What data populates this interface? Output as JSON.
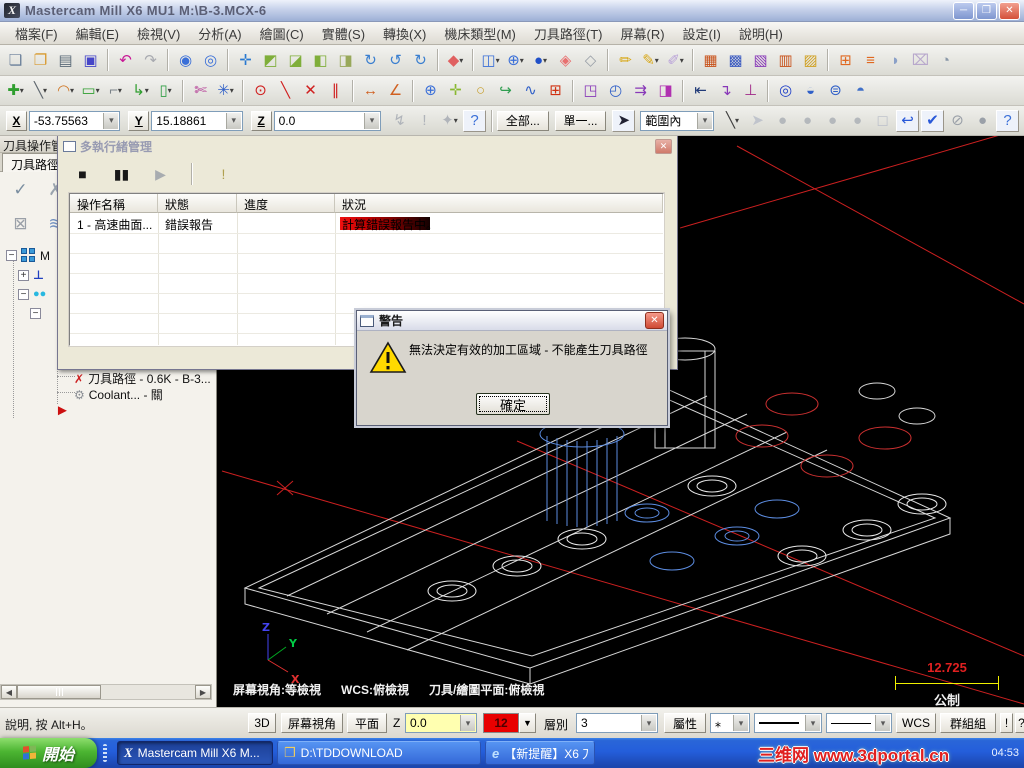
{
  "window": {
    "title": "Mastercam Mill X6 MU1  M:\\B-3.MCX-6",
    "app_initial": "X"
  },
  "menus": [
    "檔案(F)",
    "編輯(E)",
    "檢視(V)",
    "分析(A)",
    "繪圖(C)",
    "實體(S)",
    "轉換(X)",
    "機床類型(M)",
    "刀具路徑(T)",
    "屏幕(R)",
    "設定(I)",
    "說明(H)"
  ],
  "toolbars": {
    "row1": [
      {
        "name": "new-file-icon",
        "glyph": "❏",
        "color": "#6a7f9a"
      },
      {
        "name": "open-file-icon",
        "glyph": "❐",
        "color": "#d89a30"
      },
      {
        "name": "print-icon",
        "glyph": "▤",
        "color": "#5a6a78"
      },
      {
        "name": "save-icon",
        "glyph": "▣",
        "color": "#4646c8"
      },
      {
        "sep": true
      },
      {
        "name": "undo-icon",
        "glyph": "↶",
        "color": "#c81896"
      },
      {
        "name": "redo-icon",
        "glyph": "↷",
        "color": "#a8aab0"
      },
      {
        "sep": true
      },
      {
        "name": "zoom-window-icon",
        "glyph": "◉",
        "color": "#3a6fd8"
      },
      {
        "name": "zoom-unzoom-icon",
        "glyph": "◎",
        "color": "#3a6fd8"
      },
      {
        "sep": true
      },
      {
        "name": "fit-screen-icon",
        "glyph": "✛",
        "color": "#2878d0"
      },
      {
        "name": "gview-top-icon",
        "glyph": "◩",
        "color": "#7fae3a"
      },
      {
        "name": "gview-front-icon",
        "glyph": "◪",
        "color": "#7fae3a"
      },
      {
        "name": "gview-side-icon",
        "glyph": "◧",
        "color": "#7fae3a"
      },
      {
        "name": "gview-back-icon",
        "glyph": "◨",
        "color": "#98a85a"
      },
      {
        "name": "rotate-xy-icon",
        "glyph": "↻",
        "color": "#3a7fd0"
      },
      {
        "name": "rotate-xz-icon",
        "glyph": "↺",
        "color": "#3a7fd0"
      },
      {
        "name": "rotate-yz-icon",
        "glyph": "↻",
        "color": "#3a7fd0"
      },
      {
        "sep": true
      },
      {
        "name": "shading-settings-icon",
        "glyph": "◆",
        "color": "#e06060",
        "caret": true
      },
      {
        "sep": true
      },
      {
        "name": "wireframe-display-icon",
        "glyph": "◫",
        "color": "#3a6fd8",
        "caret": true
      },
      {
        "name": "gview-globe-icon",
        "glyph": "⊕",
        "color": "#3a6fd8",
        "caret": true
      },
      {
        "name": "material-sphere-icon",
        "glyph": "●",
        "color": "#2050c8",
        "caret": true
      },
      {
        "name": "solid-shaded-icon",
        "glyph": "◈",
        "color": "#e87070"
      },
      {
        "name": "solid-wireframe-icon",
        "glyph": "◇",
        "color": "#9aa0a8"
      },
      {
        "sep": true
      },
      {
        "name": "pencil-icon",
        "glyph": "✏",
        "color": "#d8a818"
      },
      {
        "name": "pencil-multi-icon",
        "glyph": "✎",
        "color": "#d8a818",
        "caret": true
      },
      {
        "name": "blank-entity-icon",
        "glyph": "✐",
        "color": "#b8a0d8",
        "caret": true
      },
      {
        "sep": true
      },
      {
        "name": "screen-combine-icon",
        "glyph": "▦",
        "color": "#c85018"
      },
      {
        "name": "screen-result-icon",
        "glyph": "▩",
        "color": "#3858c0"
      },
      {
        "name": "screen-copy-icon",
        "glyph": "▧",
        "color": "#8838b8"
      },
      {
        "name": "screen-grid-icon",
        "glyph": "▥",
        "color": "#c85018"
      },
      {
        "name": "screen-tile-icon",
        "glyph": "▨",
        "color": "#d0a020"
      },
      {
        "sep": true
      },
      {
        "name": "mesh-grid-icon",
        "glyph": "⊞",
        "color": "#e06820"
      },
      {
        "name": "mesh-lines-icon",
        "glyph": "≡",
        "color": "#e06820"
      },
      {
        "name": "shade-half-icon",
        "glyph": "◗",
        "color": "#8aa0c8"
      },
      {
        "name": "erase-tool-icon",
        "glyph": "⌧",
        "color": "#b8a8cc"
      },
      {
        "name": "clipped-edge-icon",
        "glyph": "◔",
        "color": "#8a98a8"
      }
    ],
    "row2": [
      {
        "name": "create-point-icon",
        "glyph": "✚",
        "color": "#2f9e2f",
        "caret": true
      },
      {
        "name": "create-line-icon",
        "glyph": "╲",
        "color": "#606870",
        "caret": true
      },
      {
        "name": "create-arc-icon",
        "glyph": "◠",
        "color": "#d07828",
        "caret": true
      },
      {
        "name": "create-rect-icon",
        "glyph": "▭",
        "color": "#2f9e2f",
        "caret": true
      },
      {
        "name": "create-fillet-icon",
        "glyph": "⌐",
        "color": "#7a8288",
        "caret": true
      },
      {
        "name": "create-spline-icon",
        "glyph": "↳",
        "color": "#2f9e2f",
        "caret": true
      },
      {
        "name": "create-cylinder-icon",
        "glyph": "▯",
        "color": "#2f9e44",
        "caret": true
      },
      {
        "sep": true
      },
      {
        "name": "trim-break-icon",
        "glyph": "✄",
        "color": "#b03090"
      },
      {
        "name": "xform-stretch-icon",
        "glyph": "✳",
        "color": "#3060c8",
        "caret": true
      },
      {
        "sep": true
      },
      {
        "name": "point-origin-icon",
        "glyph": "⊙",
        "color": "#d02020"
      },
      {
        "name": "sketch-line-red-icon",
        "glyph": "╲",
        "color": "#d02020"
      },
      {
        "name": "delete-entities-icon",
        "glyph": "✕",
        "color": "#d02020"
      },
      {
        "name": "delete-duplicates-icon",
        "glyph": "∥",
        "color": "#d02020"
      },
      {
        "sep": true
      },
      {
        "name": "analyze-distance-icon",
        "glyph": "↔",
        "color": "#d06020"
      },
      {
        "name": "analyze-angle-icon",
        "glyph": "∠",
        "color": "#d06020"
      },
      {
        "sep": true
      },
      {
        "name": "wcs-globe-icon",
        "glyph": "⊕",
        "color": "#3a6fd8"
      },
      {
        "name": "sketch-plus-icon",
        "glyph": "✛",
        "color": "#88b830"
      },
      {
        "name": "circle-entity-icon",
        "glyph": "○",
        "color": "#c8a030"
      },
      {
        "name": "curve-flow-icon",
        "glyph": "↪",
        "color": "#2f9e50"
      },
      {
        "name": "surface-wave-icon",
        "glyph": "∿",
        "color": "#3060c8"
      },
      {
        "name": "mesh-frame-icon",
        "glyph": "⊞",
        "color": "#d03010"
      },
      {
        "sep": true
      },
      {
        "name": "xform-translate-icon",
        "glyph": "◳",
        "color": "#8838b8"
      },
      {
        "name": "xform-rotate-icon",
        "glyph": "◴",
        "color": "#3060c8"
      },
      {
        "name": "xform-offset-icon",
        "glyph": "⇉",
        "color": "#8838b8"
      },
      {
        "name": "xform-mirror-icon",
        "glyph": "◨",
        "color": "#b030b0"
      },
      {
        "sep": true
      },
      {
        "name": "align-icon",
        "glyph": "⇤",
        "color": "#203a78"
      },
      {
        "name": "nesting-icon",
        "glyph": "↴",
        "color": "#8838b8"
      },
      {
        "name": "project-icon",
        "glyph": "⊥",
        "color": "#a02888"
      },
      {
        "sep": true
      },
      {
        "name": "spiral-toolpath-icon",
        "glyph": "◎",
        "color": "#2040c8"
      },
      {
        "name": "pocket-toolpath-icon",
        "glyph": "◒",
        "color": "#3060c8"
      },
      {
        "name": "face-toolpath-icon",
        "glyph": "⊜",
        "color": "#3060c8"
      },
      {
        "name": "drill-toolpath-icon",
        "glyph": "◓",
        "color": "#4070c8"
      }
    ],
    "ribbon_a": [
      {
        "name": "fast-point-icon",
        "glyph": "↯",
        "color": "#b0b4ba"
      },
      {
        "name": "guess-icon",
        "glyph": "!",
        "color": "#b0b4ba"
      },
      {
        "name": "autocursor-icon",
        "glyph": "✦",
        "color": "#b0b4ba",
        "caret": true
      },
      {
        "name": "help-icon",
        "glyph": "?",
        "color": "#3a6fd8",
        "boxed": true
      }
    ],
    "ribbon_b": [
      {
        "name": "sketch-line-small-icon",
        "glyph": "╲",
        "color": "#404040",
        "caret": true
      },
      {
        "name": "select-cursor-icon",
        "glyph": "➤",
        "color": "#c0c4cc"
      },
      {
        "name": "select-solids-1-icon",
        "glyph": "●",
        "color": "#b4b8bc"
      },
      {
        "name": "select-solids-2-icon",
        "glyph": "●",
        "color": "#b4b8bc"
      },
      {
        "name": "select-solids-3-icon",
        "glyph": "●",
        "color": "#b4b8bc"
      },
      {
        "name": "select-solids-4-icon",
        "glyph": "●",
        "color": "#b4b8bc"
      },
      {
        "name": "select-cube-icon",
        "glyph": "◻",
        "color": "#c0c4cc"
      },
      {
        "name": "undo-selection-icon",
        "glyph": "↩",
        "color": "#2858d8",
        "boxed": true
      },
      {
        "name": "end-selection-icon",
        "glyph": "✔",
        "color": "#2858d8",
        "boxed": true
      },
      {
        "name": "clear-selection-icon",
        "glyph": "⊘",
        "color": "#9aa0a8"
      },
      {
        "name": "select-sphere-icon",
        "glyph": "●",
        "color": "#9aa0a8"
      },
      {
        "name": "help-2-icon",
        "glyph": "?",
        "color": "#3a6fd8",
        "boxed": true
      }
    ],
    "panel_row1": [
      {
        "name": "select-all-operations-icon",
        "glyph": "✓",
        "color": "#7a8ea0"
      },
      {
        "name": "clear-all-operations-icon",
        "glyph": "✗",
        "color": "#9aa4ae"
      }
    ],
    "panel_row2": [
      {
        "name": "lock-icon",
        "glyph": "⊠",
        "color": "#9aa0a8"
      },
      {
        "name": "filter-waves-icon",
        "glyph": "≋",
        "color": "#6f8fc0"
      }
    ],
    "thread_dialog": [
      {
        "name": "stop-icon",
        "glyph": "■",
        "color": "#181818"
      },
      {
        "name": "pause-icon",
        "glyph": "▮▮",
        "color": "#181818"
      },
      {
        "name": "resume-icon",
        "glyph": "▶",
        "color": "#a8acb0"
      },
      {
        "sep": true
      },
      {
        "name": "alert-icon",
        "glyph": "!",
        "color": "#b0a050"
      }
    ]
  },
  "ribbon": {
    "x_label": "X",
    "x_value": "-53.75563",
    "y_label": "Y",
    "y_value": "15.18861",
    "z_label": "Z",
    "z_value": "0.0",
    "all_button": "全部...",
    "single_button": "單一...",
    "range_selected": "範圍內"
  },
  "left_panel": {
    "caption": "刀具操作管",
    "tab": "刀具路徑",
    "tree": {
      "root_label": "M",
      "toolpath_item": "刀具路徑 - 0.6K - B-3...",
      "coolant_item": "Coolant... - 關"
    }
  },
  "thread_dialog": {
    "title": "多執行緒管理",
    "columns": [
      "操作名稱",
      "狀態",
      "進度",
      "狀況"
    ],
    "row": {
      "name": "1 - 高速曲面...",
      "status": "錯誤報告",
      "progress_colors": [
        "#f01010",
        "#120000"
      ],
      "detail": "計算錯誤報告中。"
    }
  },
  "warning_dialog": {
    "title": "警告",
    "message": "無法決定有效的加工區域 - 不能產生刀具路徑",
    "ok_label": "確定",
    "icon_color": "#ffd900"
  },
  "viewport": {
    "gview_status": "屏幕視角:等檢視",
    "wcs_status": "WCS:俯檢視",
    "plane_status": "刀具/繪圖平面:俯檢視",
    "scale_value": "12.725",
    "scale_unit": "公制",
    "axis_x": "X",
    "axis_y": "Y",
    "axis_z": "Z"
  },
  "bottom_bar": {
    "hint": "說明, 按 Alt+H。",
    "threed_btn": "3D",
    "gview_btn": "屏幕視角",
    "plane_btn": "平面",
    "z_label": "Z",
    "z_value": "0.0",
    "color_value": "12",
    "level_label": "層別",
    "level_value": "3",
    "attributes_btn": "屬性",
    "point_style": "⁎",
    "wcs_btn": "WCS",
    "groups_btn": "群組組",
    "excl_btn": "!",
    "help_btn": "?"
  },
  "taskbar": {
    "start_label": "開始",
    "tasks": [
      {
        "label": "Mastercam Mill X6 M...",
        "glyph": "X"
      },
      {
        "label": "D:\\TDDOWNLOAD",
        "glyph": "❒"
      },
      {
        "label": "【新提醒】X6 刀路,...",
        "glyph": "e"
      }
    ],
    "tray_time": "04:53",
    "watermark": "三维网 www.3dportal.cn"
  },
  "icons": {
    "minimize": "─",
    "maximize": "❐",
    "close": "✕",
    "collapse": "−",
    "expand": "+",
    "toolpath_error": "✗",
    "coolant": "⚙",
    "insert_arrow": "►"
  },
  "accents": {
    "taskbar_blue": "#245edb",
    "warning_yellow": "#ffd900",
    "watermark_red": "#e02020",
    "progress_red": "#f01010",
    "error_bar_end": "#120000"
  }
}
